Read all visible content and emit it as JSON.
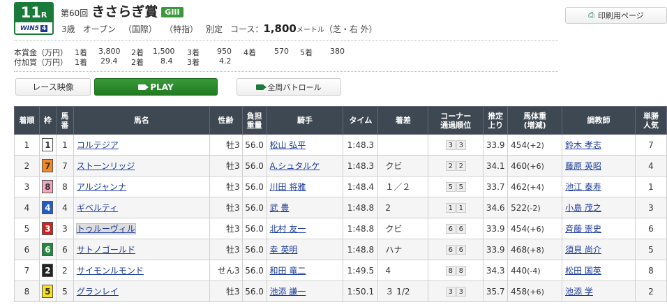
{
  "race_number": "11",
  "race_number_suffix": "R",
  "win5_label": "WIN5",
  "win5_number": "4",
  "kai": "第60回",
  "race_name": "きさらぎ賞",
  "grade": "GIII",
  "conditions": {
    "age": "3歳",
    "class": "オープン",
    "intl": "（国際）",
    "special": "（特指）",
    "weight": "別定",
    "course_label": "コース：",
    "distance": "1,800",
    "unit": "メートル",
    "surface": "（芝・右 外）"
  },
  "print_button": "印刷用ページ",
  "prize": {
    "row1_label": "本賞金（万円）",
    "row2_label": "付加賞（万円）",
    "row1": [
      {
        "place": "1着",
        "amount": "3,800"
      },
      {
        "place": "2着",
        "amount": "1,500"
      },
      {
        "place": "3着",
        "amount": "950"
      },
      {
        "place": "4着",
        "amount": "570"
      },
      {
        "place": "5着",
        "amount": "380"
      }
    ],
    "row2": [
      {
        "place": "1着",
        "amount": "29.4"
      },
      {
        "place": "2着",
        "amount": "8.4"
      },
      {
        "place": "3着",
        "amount": "4.2"
      }
    ]
  },
  "buttons": {
    "video": "レース映像",
    "play": "PLAY",
    "patrol": "全周パトロール"
  },
  "table": {
    "headers": {
      "rank": "着順",
      "waku": "枠",
      "umaban1": "馬",
      "umaban2": "番",
      "name": "馬名",
      "sex_age": "性齢",
      "weight1": "負担",
      "weight2": "重量",
      "jockey": "騎手",
      "time": "タイム",
      "margin": "着差",
      "corner1": "コーナー",
      "corner2": "通過順位",
      "last1": "推定",
      "last2": "上り",
      "body1": "馬体重",
      "body2": "(増減)",
      "trainer": "調教師",
      "pop1": "単勝",
      "pop2": "人気"
    },
    "rows": [
      {
        "rank": "1",
        "waku": "1",
        "waku_color": "#ffffff",
        "waku_text": "#333333",
        "umaban": "1",
        "name": "コルテジア",
        "sex_age": "牡3",
        "weight": "56.0",
        "jockey": "松山 弘平",
        "time": "1:48.3",
        "margin": "",
        "c1": "3",
        "c2": "3",
        "last": "33.9",
        "body": "454",
        "diff": "(+2)",
        "trainer": "鈴木 孝志",
        "pop": "7"
      },
      {
        "rank": "2",
        "waku": "7",
        "waku_color": "#f5891f",
        "waku_text": "#333333",
        "umaban": "7",
        "name": "ストーンリッジ",
        "sex_age": "牡3",
        "weight": "56.0",
        "jockey": "A.シュタルケ",
        "time": "1:48.3",
        "margin": "クビ",
        "c1": "2",
        "c2": "2",
        "last": "34.1",
        "body": "460",
        "diff": "(+6)",
        "trainer": "藤原 英昭",
        "pop": "4"
      },
      {
        "rank": "3",
        "waku": "8",
        "waku_color": "#f4a6c0",
        "waku_text": "#333333",
        "umaban": "8",
        "name": "アルジャンナ",
        "sex_age": "牡3",
        "weight": "56.0",
        "jockey": "川田 将雅",
        "time": "1:48.4",
        "margin": "１／２",
        "c1": "5",
        "c2": "5",
        "last": "33.7",
        "body": "462",
        "diff": "(+4)",
        "trainer": "池江 泰寿",
        "pop": "1"
      },
      {
        "rank": "4",
        "waku": "4",
        "waku_color": "#1e5cc8",
        "waku_text": "#ffffff",
        "umaban": "4",
        "name": "ギベルティ",
        "sex_age": "牡3",
        "weight": "56.0",
        "jockey": "武 豊",
        "time": "1:48.8",
        "margin": "2",
        "c1": "1",
        "c2": "1",
        "last": "34.6",
        "body": "522",
        "diff": "(-2)",
        "trainer": "小島 茂之",
        "pop": "3"
      },
      {
        "rank": "5",
        "waku": "3",
        "waku_color": "#d42020",
        "waku_text": "#ffffff",
        "umaban": "3",
        "name": "トゥルーヴィル",
        "sex_age": "牡3",
        "weight": "56.0",
        "jockey": "北村 友一",
        "time": "1:48.8",
        "margin": "クビ",
        "c1": "6",
        "c2": "6",
        "last": "33.9",
        "body": "454",
        "diff": "(+6)",
        "trainer": "斉藤 崇史",
        "pop": "6"
      },
      {
        "rank": "6",
        "waku": "6",
        "waku_color": "#1f8a3a",
        "waku_text": "#ffffff",
        "umaban": "6",
        "name": "サトノゴールド",
        "sex_age": "牡3",
        "weight": "56.0",
        "jockey": "幸 英明",
        "time": "1:48.8",
        "margin": "ハナ",
        "c1": "6",
        "c2": "6",
        "last": "33.9",
        "body": "468",
        "diff": "(+8)",
        "trainer": "須貝 尚介",
        "pop": "5"
      },
      {
        "rank": "7",
        "waku": "2",
        "waku_color": "#222222",
        "waku_text": "#ffffff",
        "umaban": "2",
        "name": "サイモンルモンド",
        "sex_age": "せん3",
        "weight": "56.0",
        "jockey": "和田 竜二",
        "time": "1:49.5",
        "margin": "4",
        "c1": "8",
        "c2": "8",
        "last": "34.3",
        "body": "440",
        "diff": "(-4)",
        "trainer": "松田 国英",
        "pop": "8"
      },
      {
        "rank": "8",
        "waku": "5",
        "waku_color": "#f7e01c",
        "waku_text": "#333333",
        "umaban": "5",
        "name": "グランレイ",
        "sex_age": "牡3",
        "weight": "56.0",
        "jockey": "池添 謙一",
        "time": "1:50.1",
        "margin": "３ 1/2",
        "c1": "3",
        "c2": "3",
        "last": "35.7",
        "body": "458",
        "diff": "(+6)",
        "trainer": "池添 学",
        "pop": "2"
      }
    ]
  }
}
